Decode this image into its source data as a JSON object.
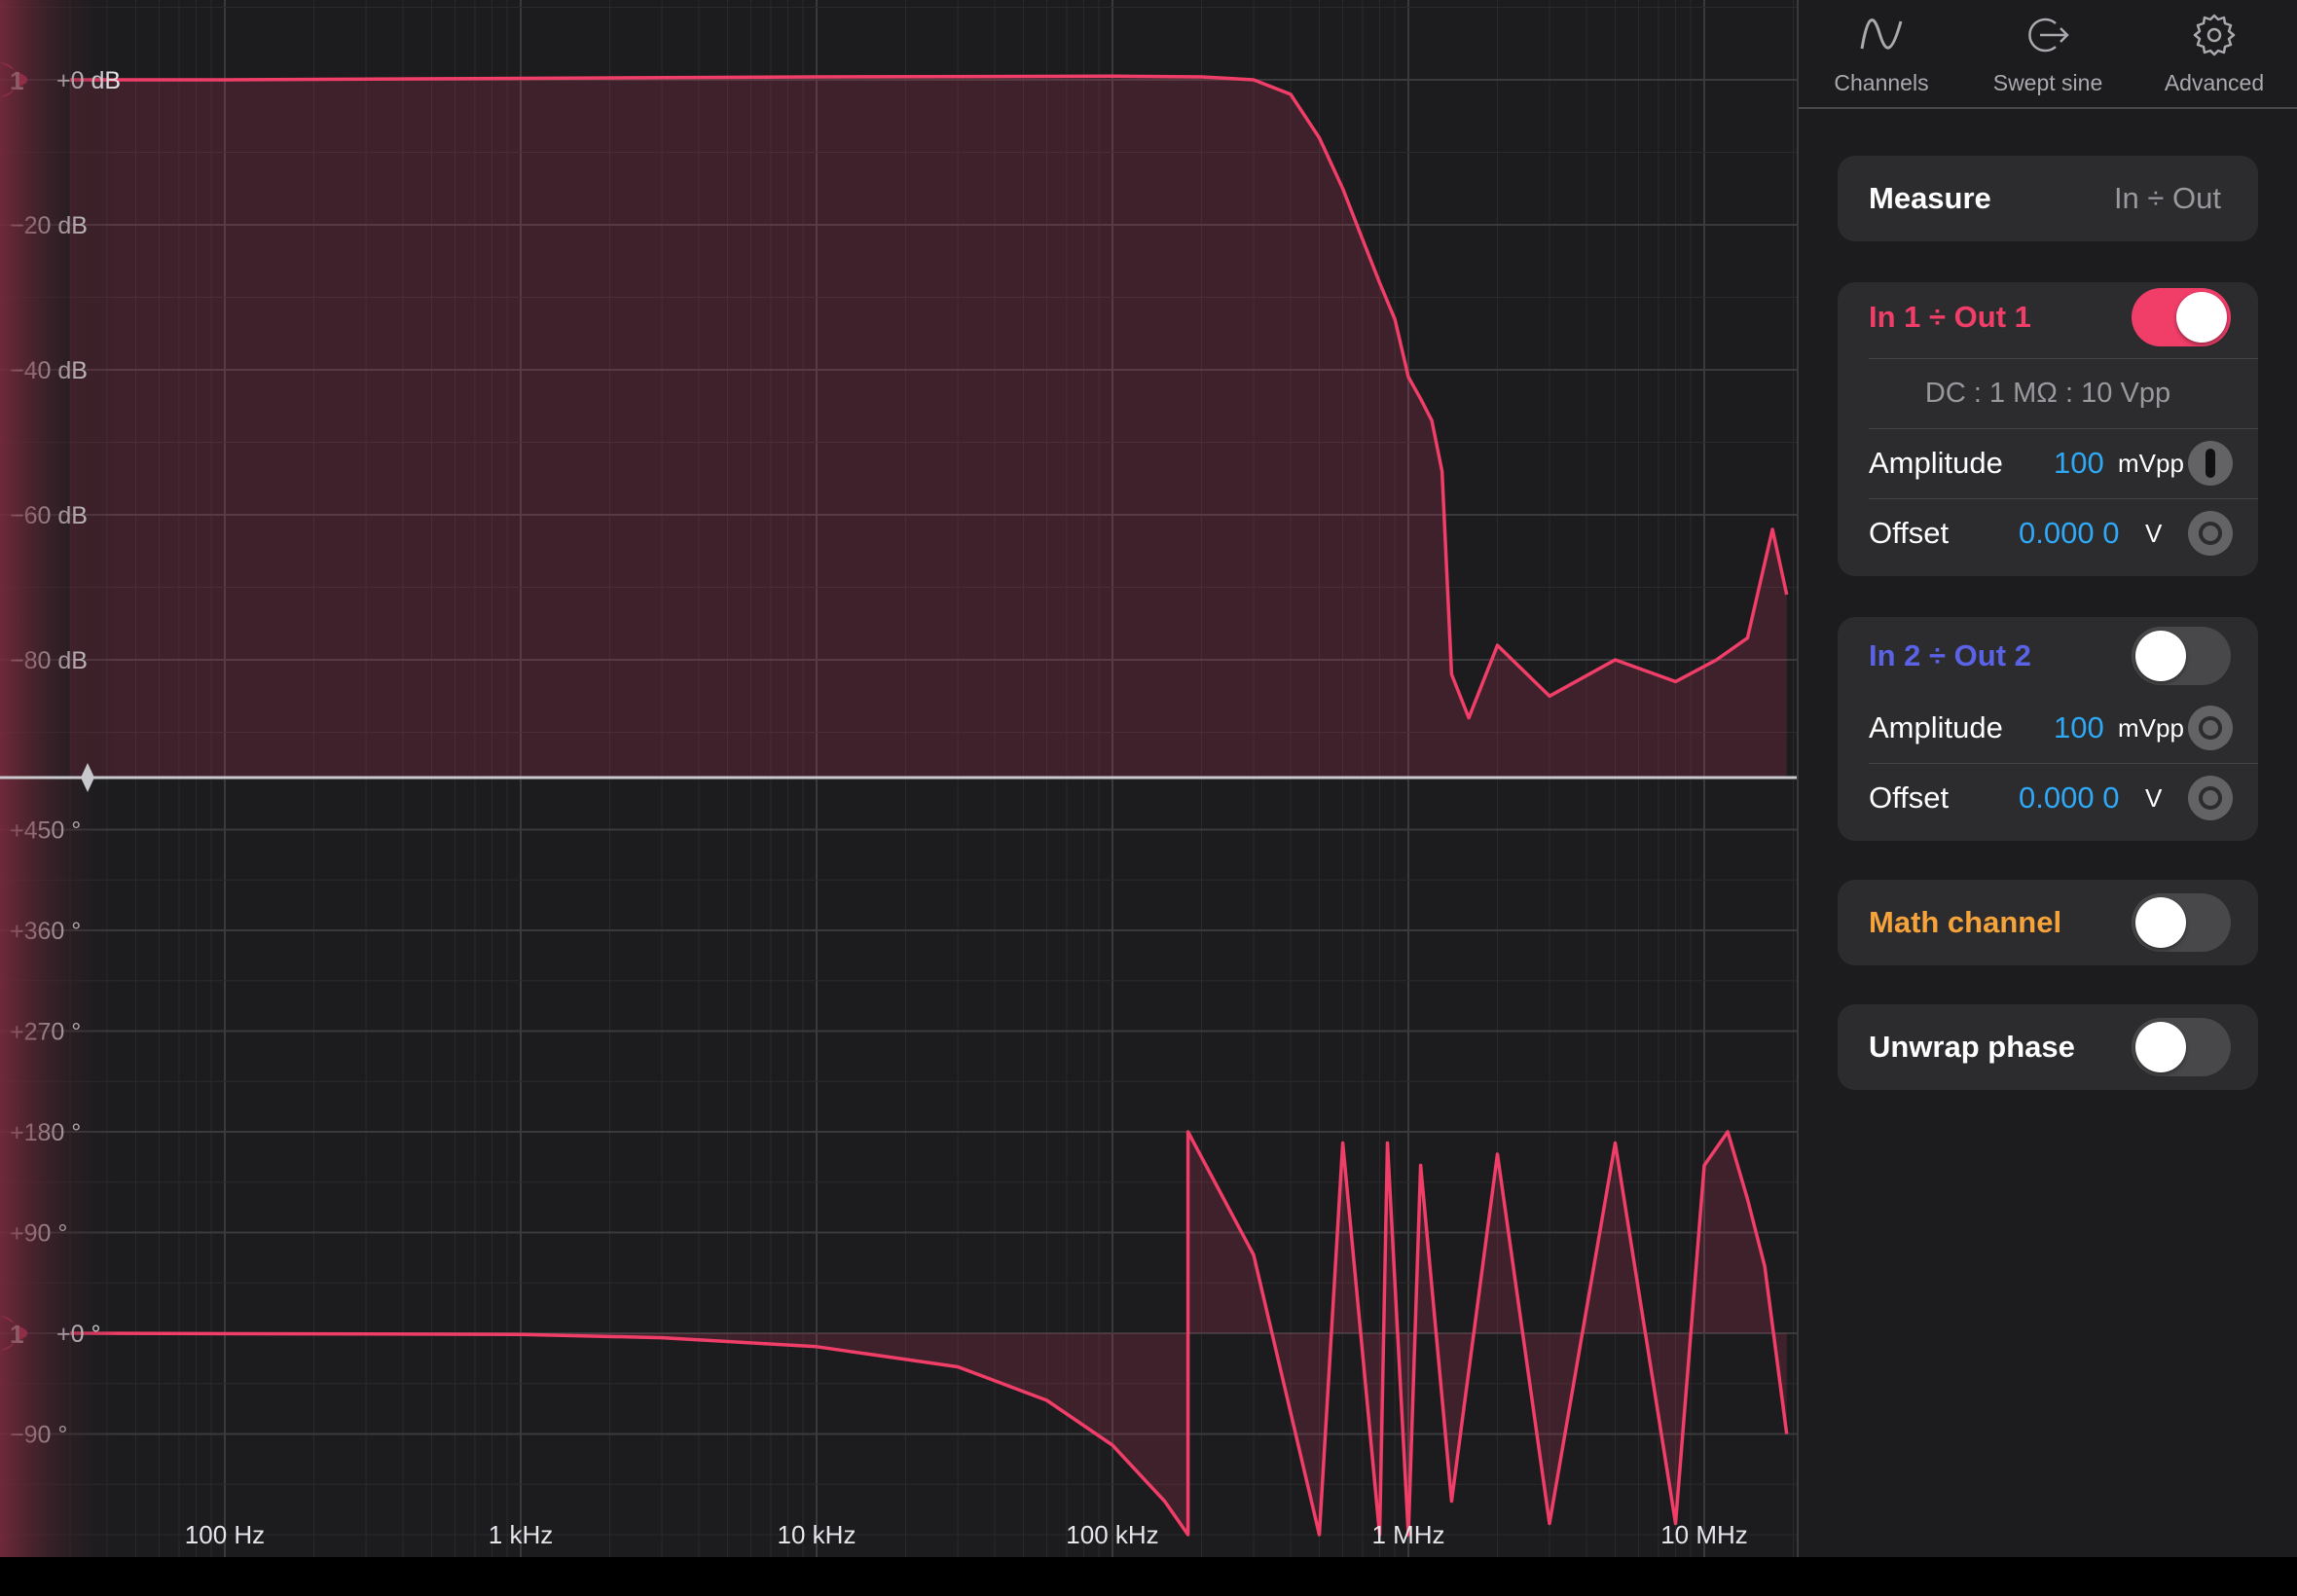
{
  "colors": {
    "trace": "#f03e69",
    "accent_blue": "#2fa8f5",
    "ch2": "#5a62e6",
    "math": "#f5a33a",
    "panel": "#2c2c2e"
  },
  "tabs": [
    {
      "label": "Channels",
      "icon": "sine-wave-icon"
    },
    {
      "label": "Swept sine",
      "icon": "swept-sine-icon"
    },
    {
      "label": "Advanced",
      "icon": "gear-icon"
    }
  ],
  "measure": {
    "label": "Measure",
    "value": "In ÷ Out"
  },
  "channel1": {
    "title": "In 1 ÷ Out 1",
    "enabled": true,
    "config": "DC : 1 MΩ : 10 Vpp",
    "amplitude": {
      "label": "Amplitude",
      "value": "100",
      "unit": "mVpp"
    },
    "offset": {
      "label": "Offset",
      "value": "0.000 0",
      "unit": "V"
    }
  },
  "channel2": {
    "title": "In 2 ÷ Out 2",
    "enabled": false,
    "amplitude": {
      "label": "Amplitude",
      "value": "100",
      "unit": "mVpp"
    },
    "offset": {
      "label": "Offset",
      "value": "0.000 0",
      "unit": "V"
    }
  },
  "math_channel": {
    "label": "Math channel",
    "enabled": false
  },
  "unwrap_phase": {
    "label": "Unwrap phase",
    "enabled": false
  },
  "marker_label": "1",
  "chart_data": [
    {
      "type": "line",
      "title": "",
      "xlabel": "",
      "ylabel": "",
      "x_scale": "log",
      "x_ticks": [
        "100 Hz",
        "1 kHz",
        "10 kHz",
        "100 kHz",
        "1 MHz",
        "10 MHz"
      ],
      "y_ticks": [
        "+0 dB",
        "−20 dB",
        "−40 dB",
        "−60 dB",
        "−80 dB"
      ],
      "ylim": [
        -96,
        11
      ],
      "grid": true,
      "series": [
        {
          "name": "",
          "x": [
            30,
            100,
            1000,
            10000,
            100000,
            200000,
            300000,
            400000,
            500000,
            600000,
            700000,
            800000,
            900000,
            1000000,
            1100000,
            1200000,
            1300000,
            1400000,
            1600000,
            2000000,
            3000000,
            5000000,
            8000000,
            11000000,
            14000000,
            17000000,
            19000000
          ],
          "y": [
            0,
            0,
            0.2,
            0.4,
            0.5,
            0.4,
            0,
            -2,
            -8,
            -15,
            -22,
            -28,
            -33,
            -41,
            -44,
            -47,
            -54,
            -82,
            -88,
            -78,
            -85,
            -80,
            -83,
            -80,
            -77,
            -62,
            -71
          ]
        }
      ]
    },
    {
      "type": "line",
      "title": "",
      "xlabel": "",
      "ylabel": "",
      "x_scale": "log",
      "x_ticks": [
        "100 Hz",
        "1 kHz",
        "10 kHz",
        "100 kHz",
        "1 MHz",
        "10 MHz"
      ],
      "y_ticks": [
        "+450 °",
        "+360 °",
        "+270 °",
        "+180 °",
        "+90 °",
        "+0 °",
        "−90 °"
      ],
      "ylim": [
        -200,
        495
      ],
      "grid": true,
      "series": [
        {
          "name": "",
          "x": [
            30,
            1000,
            3000,
            10000,
            30000,
            60000,
            100000,
            150000,
            180000,
            180001,
            300000,
            500000,
            600000,
            600001,
            800000,
            850000,
            850001,
            1000000,
            1100000,
            1100001,
            1400000,
            2000000,
            3000000,
            5000000,
            8000000,
            10000000,
            12000000,
            14000000,
            16000000,
            19000000
          ],
          "y": [
            0,
            -1,
            -4,
            -12,
            -30,
            -60,
            -100,
            -150,
            -180,
            180,
            70,
            -180,
            170,
            170,
            -180,
            170,
            170,
            -180,
            150,
            150,
            -150,
            160,
            -170,
            170,
            -170,
            150,
            180,
            120,
            60,
            -90
          ]
        }
      ]
    }
  ]
}
